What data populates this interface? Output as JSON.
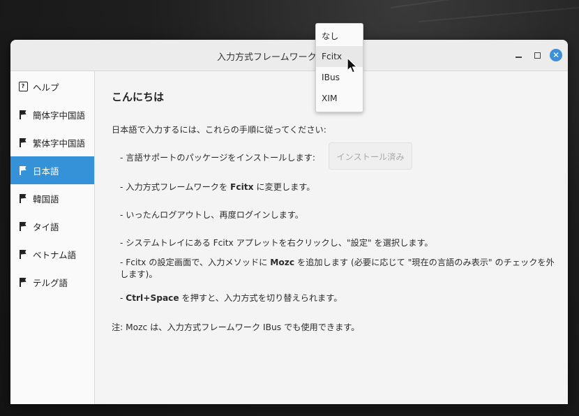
{
  "window": {
    "title": "入力方式フレームワーク:",
    "controls": [
      "minimize-icon",
      "maximize-icon",
      "close-icon"
    ],
    "close_glyph": "✕"
  },
  "sidebar": {
    "items": [
      {
        "label": "ヘルプ",
        "icon": "help-icon",
        "active": false
      },
      {
        "label": "簡体字中国語",
        "icon": "flag-icon",
        "active": false
      },
      {
        "label": "繁体字中国語",
        "icon": "flag-icon",
        "active": false
      },
      {
        "label": "日本語",
        "icon": "flag-icon",
        "active": true
      },
      {
        "label": "韓国語",
        "icon": "flag-icon",
        "active": false
      },
      {
        "label": "タイ語",
        "icon": "flag-icon",
        "active": false
      },
      {
        "label": "ベトナム語",
        "icon": "flag-icon",
        "active": false
      },
      {
        "label": "テルグ語",
        "icon": "flag-icon",
        "active": false
      }
    ]
  },
  "content": {
    "greeting": "こんにちは",
    "intro": "日本語で入力するには、これらの手順に従ってください:",
    "step1": "- 言語サポートのパッケージをインストールします:",
    "install_button": "インストール済み",
    "step2_pre": "- 入力方式フレームワークを ",
    "step2_bold": "Fcitx",
    "step2_post": " に変更します。",
    "step3": "- いったんログアウトし、再度ログインします。",
    "step4": "- システムトレイにある Fcitx アプレットを右クリックし、\"設定\" を選択します。",
    "step5_pre": "- Fcitx の設定画面で、入力メソッドに ",
    "step5_bold": "Mozc",
    "step5_post": " を追加します (必要に応じて \"現在の言語のみ表示\" のチェックを外します)。",
    "step6_bold": "Ctrl+Space",
    "step6_post": " を押すと、入力方式を切り替えられます。",
    "note": "注: Mozc は、入力方式フレームワーク IBus でも使用できます。"
  },
  "dropdown": {
    "options": [
      "なし",
      "Fcitx",
      "IBus",
      "XIM"
    ],
    "hovered": "Fcitx"
  },
  "colors": {
    "accent": "#3592d8",
    "close_button": "#3d8fd9"
  }
}
